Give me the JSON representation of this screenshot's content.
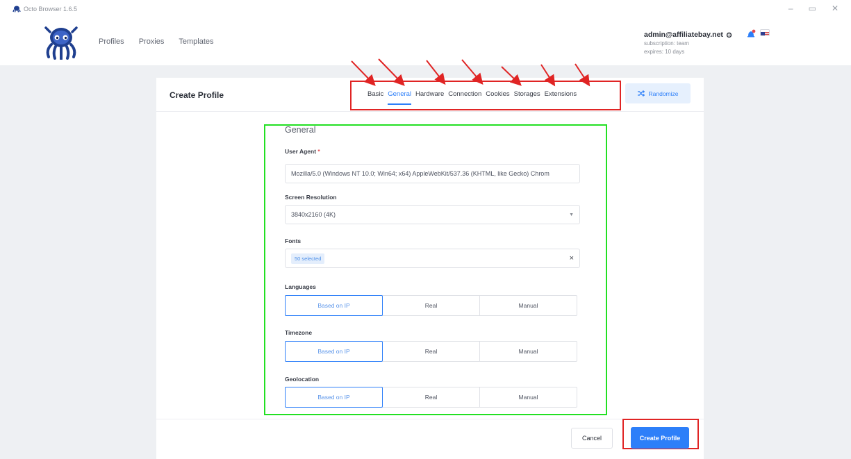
{
  "window": {
    "title": "Octo Browser 1.6.5",
    "controls": [
      "–",
      "▭",
      "✕"
    ]
  },
  "nav": {
    "items": [
      "Profiles",
      "Proxies",
      "Templates"
    ]
  },
  "account": {
    "email": "admin@affiliatebay.net",
    "subscription": "subscription: team",
    "expires": "expires: 10 days"
  },
  "panel": {
    "title": "Create Profile",
    "tabs": [
      "Basic",
      "General",
      "Hardware",
      "Connection",
      "Cookies",
      "Storages",
      "Extensions"
    ],
    "active_tab": "General",
    "randomize_label": "Randomize"
  },
  "general": {
    "section_title": "General",
    "user_agent_label": "User Agent",
    "user_agent_required": "*",
    "user_agent_value": "Mozilla/5.0 (Windows NT 10.0; Win64; x64) AppleWebKit/537.36 (KHTML, like Gecko) Chrom",
    "screen_resolution_label": "Screen Resolution",
    "screen_resolution_value": "3840x2160 (4K)",
    "fonts_label": "Fonts",
    "fonts_chip": "50 selected",
    "fonts_clear": "×",
    "languages_label": "Languages",
    "languages_options": [
      "Based on IP",
      "Real",
      "Manual"
    ],
    "timezone_label": "Timezone",
    "timezone_options": [
      "Based on IP",
      "Real",
      "Manual"
    ],
    "geolocation_label": "Geolocation",
    "geolocation_options": [
      "Based on IP",
      "Real",
      "Manual"
    ]
  },
  "footer": {
    "cancel_label": "Cancel",
    "create_label": "Create Profile"
  },
  "colors": {
    "accent": "#2d7ff9",
    "annotation_red": "#e02424",
    "annotation_green": "#22e022"
  }
}
